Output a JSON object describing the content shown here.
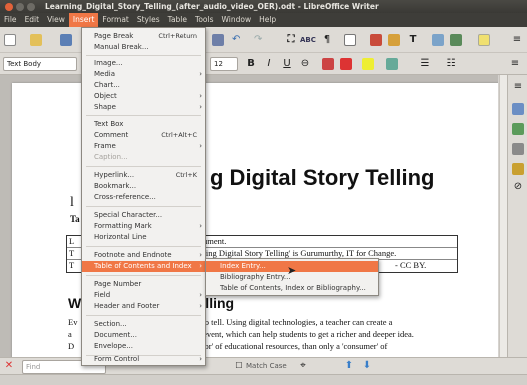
{
  "window": {
    "title": "Learning_Digital_Story_Telling_(after_audio_video_OER).odt - LibreOffice Writer"
  },
  "menubar": {
    "items": [
      "File",
      "Edit",
      "View",
      "Insert",
      "Format",
      "Styles",
      "Table",
      "Tools",
      "Window",
      "Help"
    ],
    "active": "Insert"
  },
  "toolbar": {
    "paragraph_style": "Text Body",
    "font_size": "12",
    "bold": "B",
    "italic": "I",
    "underline": "U"
  },
  "insert_menu": {
    "items": [
      {
        "label": "Page Break",
        "shortcut": "Ctrl+Return"
      },
      {
        "label": "Manual Break..."
      },
      {
        "label": "Image..."
      },
      {
        "label": "Media",
        "submenu": true
      },
      {
        "label": "Chart..."
      },
      {
        "label": "Object",
        "submenu": true
      },
      {
        "label": "Shape",
        "submenu": true
      },
      {
        "label": "Text Box"
      },
      {
        "label": "Comment",
        "shortcut": "Ctrl+Alt+C"
      },
      {
        "label": "Frame",
        "submenu": true
      },
      {
        "label": "Caption...",
        "disabled": true
      },
      {
        "label": "Hyperlink...",
        "shortcut": "Ctrl+K"
      },
      {
        "label": "Bookmark..."
      },
      {
        "label": "Cross-reference..."
      },
      {
        "label": "Special Character..."
      },
      {
        "label": "Formatting Mark",
        "submenu": true
      },
      {
        "label": "Horizontal Line"
      },
      {
        "label": "Footnote and Endnote",
        "submenu": true
      },
      {
        "label": "Table of Contents and Index",
        "submenu": true,
        "active": true
      },
      {
        "label": "Page Number"
      },
      {
        "label": "Field",
        "submenu": true
      },
      {
        "label": "Header and Footer",
        "submenu": true
      },
      {
        "label": "Section..."
      },
      {
        "label": "Document..."
      },
      {
        "label": "Envelope..."
      },
      {
        "label": "Form Control",
        "submenu": true
      }
    ]
  },
  "toc_submenu": {
    "items": [
      "Index Entry...",
      "Bibliography Entry...",
      "Table of Contents, Index or Bibliography..."
    ]
  },
  "document": {
    "title": "g Digital Story Telling",
    "letter_l": "l",
    "ta": "Ta",
    "table_rows": [
      {
        "left": "L",
        "right": "ocument."
      },
      {
        "left": "T",
        "right": "arning Digital Story Telling' is Gurumurthy, IT for Change."
      },
      {
        "left": "T",
        "right": "- CC BY."
      }
    ],
    "section_left": "W",
    "section_right": "Telling",
    "body_lines": [
      {
        "left": "Ev",
        "right": "ries to tell. Using digital technologies, a teacher can create a"
      },
      {
        "left": "a",
        "right": "r an event, which can help students to get a richer and deeper idea."
      },
      {
        "left": "D",
        "right": "creator' of educational resources, than only a 'consumer' of"
      }
    ]
  },
  "findbar": {
    "placeholder": "Find",
    "match_case": "Match Case"
  },
  "colors": {
    "accent": "#f07746",
    "menubar": "#3e3d39",
    "toolbar": "#dedbd6"
  }
}
